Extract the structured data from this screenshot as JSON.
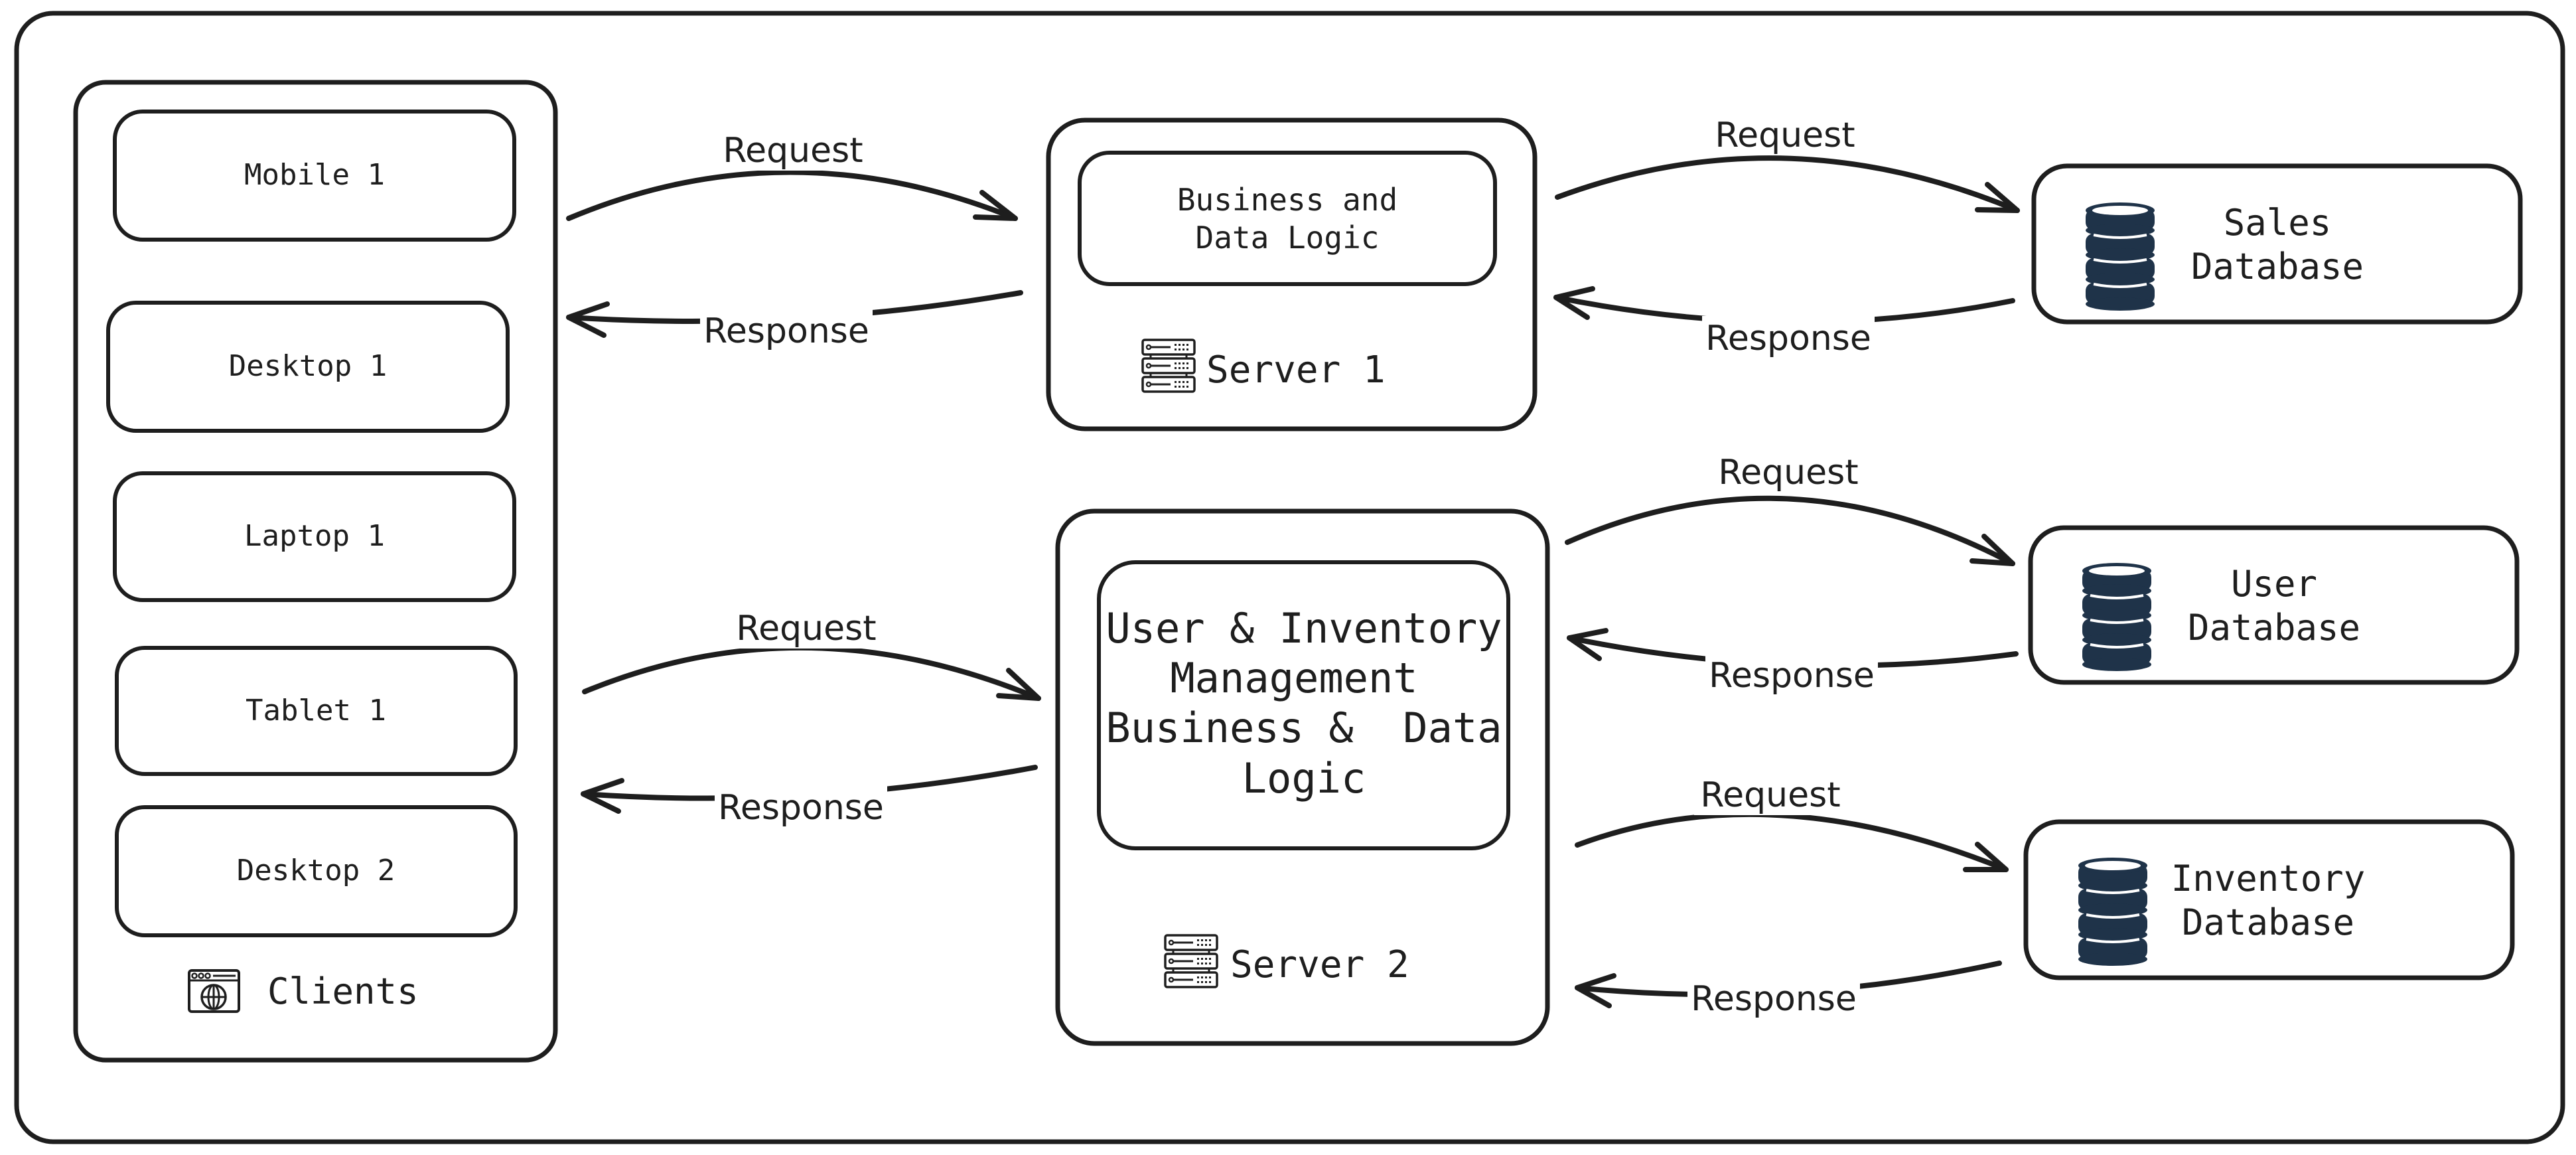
{
  "clients": {
    "title": "Clients",
    "icon": "browser-globe-icon",
    "devices": [
      "Mobile 1",
      "Desktop 1",
      "Laptop 1",
      "Tablet 1",
      "Desktop 2"
    ]
  },
  "servers": [
    {
      "name": "Server 1",
      "icon": "server-rack-icon",
      "logic_lines": [
        "Business and",
        "Data Logic"
      ]
    },
    {
      "name": "Server 2",
      "icon": "server-rack-icon",
      "logic_lines": [
        "User & Inventory",
        "Management",
        "Business &  Data",
        "Logic"
      ]
    }
  ],
  "databases": [
    {
      "lines": [
        "Sales",
        "Database"
      ],
      "icon": "database-icon"
    },
    {
      "lines": [
        "User",
        "Database"
      ],
      "icon": "database-icon"
    },
    {
      "lines": [
        "Inventory",
        "Database"
      ],
      "icon": "database-icon"
    }
  ],
  "connections": [
    {
      "from": "Clients",
      "to": "Server 1",
      "request_label": "Request",
      "response_label": "Response"
    },
    {
      "from": "Clients",
      "to": "Server 2",
      "request_label": "Request",
      "response_label": "Response"
    },
    {
      "from": "Server 1",
      "to": "Sales Database",
      "request_label": "Request",
      "response_label": "Response"
    },
    {
      "from": "Server 2",
      "to": "User Database",
      "request_label": "Request",
      "response_label": "Response"
    },
    {
      "from": "Server 2",
      "to": "Inventory Database",
      "request_label": "Request",
      "response_label": "Response"
    }
  ],
  "colors": {
    "stroke": "#1e1e1e",
    "database_icon": "#1f3349",
    "background": "#ffffff"
  }
}
